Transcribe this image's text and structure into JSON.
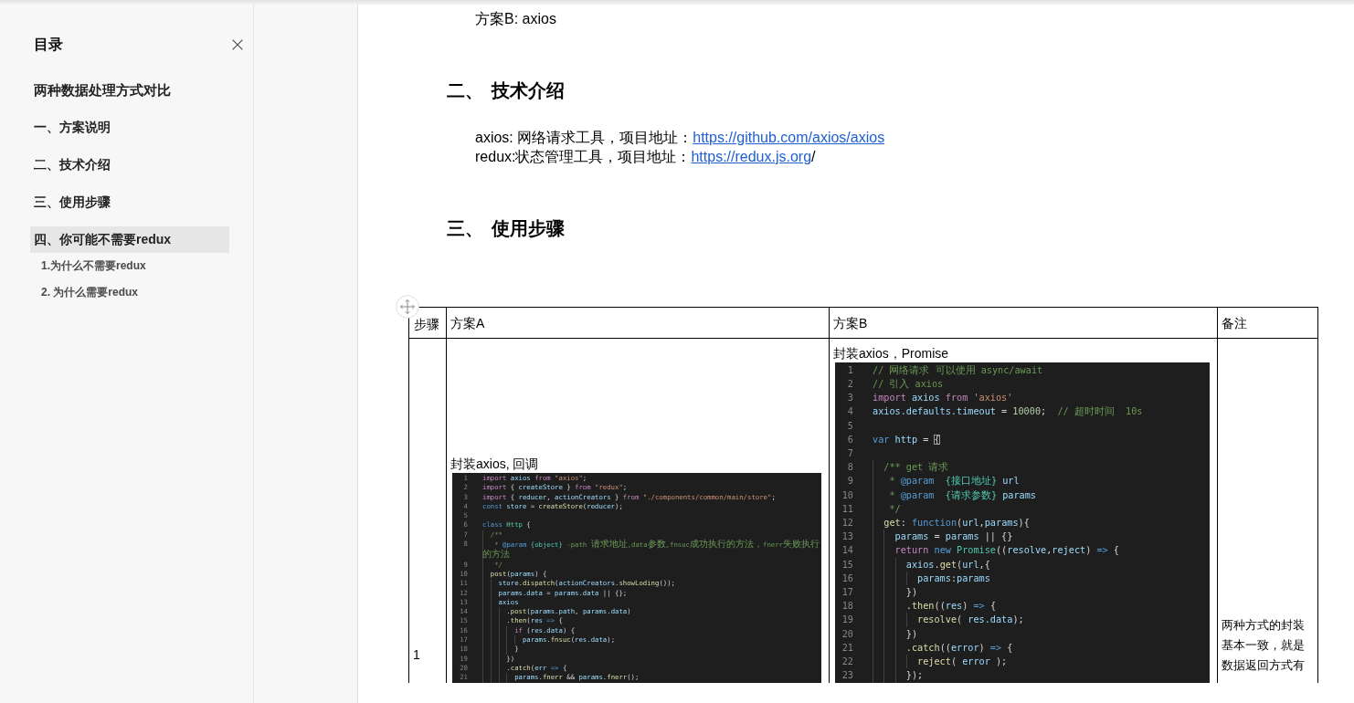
{
  "toc": {
    "title": "目录",
    "items": [
      {
        "kind": "title",
        "label": "两种数据处理方式对比",
        "selected": false
      },
      {
        "kind": "section",
        "label": "一、方案说明",
        "selected": false
      },
      {
        "kind": "section",
        "label": "二、技术介绍",
        "selected": false
      },
      {
        "kind": "section",
        "label": "三、使用步骤",
        "selected": false
      },
      {
        "kind": "section",
        "label": "四、你可能不需要redux",
        "selected": true,
        "children": [
          {
            "label": "1.为什么不需要redux",
            "selected": false
          },
          {
            "label": "2. 为什么需要redux",
            "selected": false
          }
        ]
      }
    ]
  },
  "article": {
    "intro": "方案B: axios",
    "sections": [
      {
        "number": "二、",
        "title": "技术介绍",
        "lines": [
          {
            "text": "axios: 网络请求工具，项目地址：",
            "link": "https://github.com/axios/axios"
          },
          {
            "text": "redux:状态管理工具，项目地址：",
            "link": "https://redux.js.org",
            "trailing": "/"
          }
        ]
      },
      {
        "number": "三、",
        "title": "使用步骤",
        "table": {
          "columns": [
            "步骤",
            "方案A",
            "方案B",
            "备注"
          ],
          "rows": [
            {
              "step": "1",
              "scheme_a": {
                "caption": "封装axios, 回调",
                "code": [
                  {
                    "number": "1",
                    "tokens": [
                      {
                        "text": "import",
                        "kind": "keyword"
                      },
                      {
                        "text": " axios ",
                        "kind": "variable"
                      },
                      {
                        "text": "from",
                        "kind": "keyword"
                      },
                      {
                        "text": " \"axios\"",
                        "kind": "string"
                      },
                      {
                        "text": ";",
                        "kind": "plain"
                      }
                    ]
                  },
                  {
                    "number": "2",
                    "tokens": [
                      {
                        "text": "import",
                        "kind": "keyword"
                      },
                      {
                        "text": " { ",
                        "kind": "plain"
                      },
                      {
                        "text": "createStore",
                        "kind": "variable"
                      },
                      {
                        "text": " } ",
                        "kind": "plain"
                      },
                      {
                        "text": "from",
                        "kind": "keyword"
                      },
                      {
                        "text": " \"redux\"",
                        "kind": "string"
                      },
                      {
                        "text": ";",
                        "kind": "plain"
                      }
                    ]
                  },
                  {
                    "number": "3",
                    "tokens": [
                      {
                        "text": "import",
                        "kind": "keyword"
                      },
                      {
                        "text": " { ",
                        "kind": "plain"
                      },
                      {
                        "text": "reducer",
                        "kind": "variable"
                      },
                      {
                        "text": ", ",
                        "kind": "plain"
                      },
                      {
                        "text": "actionCreators",
                        "kind": "variable"
                      },
                      {
                        "text": " } ",
                        "kind": "plain"
                      },
                      {
                        "text": "from",
                        "kind": "keyword"
                      },
                      {
                        "text": " \"./components/common/main/store\"",
                        "kind": "string"
                      },
                      {
                        "text": ";",
                        "kind": "plain"
                      }
                    ]
                  },
                  {
                    "number": "4",
                    "tokens": [
                      {
                        "text": "const",
                        "kind": "storage"
                      },
                      {
                        "text": " store",
                        "kind": "variable"
                      },
                      {
                        "text": " = ",
                        "kind": "plain"
                      },
                      {
                        "text": "createStore",
                        "kind": "function"
                      },
                      {
                        "text": "(",
                        "kind": "plain"
                      },
                      {
                        "text": "reducer",
                        "kind": "variable"
                      },
                      {
                        "text": ");",
                        "kind": "plain"
                      }
                    ]
                  },
                  {
                    "number": "5"
                  },
                  {
                    "number": "6",
                    "tokens": [
                      {
                        "text": "class",
                        "kind": "storage"
                      },
                      {
                        "text": " Http",
                        "kind": "type"
                      },
                      {
                        "text": " {",
                        "kind": "plain"
                      }
                    ]
                  },
                  {
                    "number": "7",
                    "tokens": [
                      {
                        "text": "  /**",
                        "kind": "comment"
                      }
                    ]
                  },
                  {
                    "number": "8",
                    "tokens": [
                      {
                        "text": "   * ",
                        "kind": "comment"
                      },
                      {
                        "text": "@param",
                        "kind": "storage"
                      },
                      {
                        "text": " {object}",
                        "kind": "type"
                      },
                      {
                        "text": " -path 请求地址,data参数,fnsuc成功执行的方法，fnerr失败执行的方法",
                        "kind": "comment"
                      }
                    ]
                  },
                  {
                    "number": "9",
                    "tokens": [
                      {
                        "text": "   */",
                        "kind": "comment"
                      }
                    ]
                  },
                  {
                    "number": "10",
                    "tokens": [
                      {
                        "text": "  post",
                        "kind": "function"
                      },
                      {
                        "text": "(",
                        "kind": "plain"
                      },
                      {
                        "text": "params",
                        "kind": "variable"
                      },
                      {
                        "text": ") {",
                        "kind": "plain"
                      }
                    ]
                  },
                  {
                    "number": "11",
                    "tokens": [
                      {
                        "text": "    store",
                        "kind": "variable"
                      },
                      {
                        "text": ".",
                        "kind": "plain"
                      },
                      {
                        "text": "dispatch",
                        "kind": "function"
                      },
                      {
                        "text": "(",
                        "kind": "plain"
                      },
                      {
                        "text": "actionCreators",
                        "kind": "variable"
                      },
                      {
                        "text": ".",
                        "kind": "plain"
                      },
                      {
                        "text": "showLoding",
                        "kind": "function"
                      },
                      {
                        "text": "());",
                        "kind": "plain"
                      }
                    ]
                  },
                  {
                    "number": "12",
                    "tokens": [
                      {
                        "text": "    params.data",
                        "kind": "variable"
                      },
                      {
                        "text": " = ",
                        "kind": "plain"
                      },
                      {
                        "text": "params.data",
                        "kind": "variable"
                      },
                      {
                        "text": " || {};",
                        "kind": "plain"
                      }
                    ]
                  },
                  {
                    "number": "13",
                    "tokens": [
                      {
                        "text": "    axios",
                        "kind": "variable"
                      }
                    ]
                  },
                  {
                    "number": "14",
                    "tokens": [
                      {
                        "text": "      .",
                        "kind": "plain"
                      },
                      {
                        "text": "post",
                        "kind": "function"
                      },
                      {
                        "text": "(",
                        "kind": "plain"
                      },
                      {
                        "text": "params.path",
                        "kind": "variable"
                      },
                      {
                        "text": ", ",
                        "kind": "plain"
                      },
                      {
                        "text": "params.data",
                        "kind": "variable"
                      },
                      {
                        "text": ")",
                        "kind": "plain"
                      }
                    ]
                  },
                  {
                    "number": "15",
                    "tokens": [
                      {
                        "text": "      .",
                        "kind": "plain"
                      },
                      {
                        "text": "then",
                        "kind": "function"
                      },
                      {
                        "text": "(",
                        "kind": "plain"
                      },
                      {
                        "text": "res",
                        "kind": "variable"
                      },
                      {
                        "text": " =>",
                        "kind": "storage"
                      },
                      {
                        "text": " {",
                        "kind": "plain"
                      }
                    ]
                  },
                  {
                    "number": "16",
                    "tokens": [
                      {
                        "text": "        if",
                        "kind": "keyword"
                      },
                      {
                        "text": " (",
                        "kind": "plain"
                      },
                      {
                        "text": "res.data",
                        "kind": "variable"
                      },
                      {
                        "text": ") {",
                        "kind": "plain"
                      }
                    ]
                  },
                  {
                    "number": "17",
                    "tokens": [
                      {
                        "text": "          params",
                        "kind": "variable"
                      },
                      {
                        "text": ".",
                        "kind": "plain"
                      },
                      {
                        "text": "fnsuc",
                        "kind": "function"
                      },
                      {
                        "text": "(",
                        "kind": "plain"
                      },
                      {
                        "text": "res.data",
                        "kind": "variable"
                      },
                      {
                        "text": ");",
                        "kind": "plain"
                      }
                    ]
                  },
                  {
                    "number": "18",
                    "tokens": [
                      {
                        "text": "        }",
                        "kind": "plain"
                      }
                    ]
                  },
                  {
                    "number": "19",
                    "tokens": [
                      {
                        "text": "      })",
                        "kind": "plain"
                      }
                    ]
                  },
                  {
                    "number": "20",
                    "tokens": [
                      {
                        "text": "      .",
                        "kind": "plain"
                      },
                      {
                        "text": "catch",
                        "kind": "function"
                      },
                      {
                        "text": "(",
                        "kind": "plain"
                      },
                      {
                        "text": "err",
                        "kind": "variable"
                      },
                      {
                        "text": " =>",
                        "kind": "storage"
                      },
                      {
                        "text": " {",
                        "kind": "plain"
                      }
                    ]
                  },
                  {
                    "number": "21",
                    "tokens": [
                      {
                        "text": "        params",
                        "kind": "variable"
                      },
                      {
                        "text": ".",
                        "kind": "plain"
                      },
                      {
                        "text": "fnerr",
                        "kind": "function"
                      },
                      {
                        "text": " && ",
                        "kind": "plain"
                      },
                      {
                        "text": "params",
                        "kind": "variable"
                      },
                      {
                        "text": ".",
                        "kind": "plain"
                      },
                      {
                        "text": "fnerr",
                        "kind": "function"
                      },
                      {
                        "text": "();",
                        "kind": "plain"
                      }
                    ]
                  }
                ]
              },
              "scheme_b": {
                "caption": "封装axios，Promise",
                "code": [
                  {
                    "number": "1",
                    "tokens": [
                      {
                        "text": "// 网络请求 可以使用 async/await",
                        "kind": "comment"
                      }
                    ]
                  },
                  {
                    "number": "2",
                    "tokens": [
                      {
                        "text": "// 引入 axios",
                        "kind": "comment"
                      }
                    ]
                  },
                  {
                    "number": "3",
                    "tokens": [
                      {
                        "text": "import",
                        "kind": "keyword"
                      },
                      {
                        "text": " axios ",
                        "kind": "variable"
                      },
                      {
                        "text": "from",
                        "kind": "keyword"
                      },
                      {
                        "text": " 'axios'",
                        "kind": "string"
                      }
                    ]
                  },
                  {
                    "number": "4",
                    "tokens": [
                      {
                        "text": "axios.defaults.timeout",
                        "kind": "variable"
                      },
                      {
                        "text": " = ",
                        "kind": "plain"
                      },
                      {
                        "text": "10000",
                        "kind": "number"
                      },
                      {
                        "text": ";  ",
                        "kind": "plain"
                      },
                      {
                        "text": "// 超时时间  10s",
                        "kind": "comment"
                      }
                    ]
                  },
                  {
                    "number": "5"
                  },
                  {
                    "number": "6",
                    "tokens": [
                      {
                        "text": "var",
                        "kind": "storage"
                      },
                      {
                        "text": " http",
                        "kind": "variable"
                      },
                      {
                        "text": " = ",
                        "kind": "plain"
                      },
                      {
                        "text": "{",
                        "kind": "match"
                      }
                    ]
                  },
                  {
                    "number": "7"
                  },
                  {
                    "number": "8",
                    "tokens": [
                      {
                        "text": "  /** get 请求",
                        "kind": "comment"
                      }
                    ]
                  },
                  {
                    "number": "9",
                    "tokens": [
                      {
                        "text": "   * ",
                        "kind": "comment"
                      },
                      {
                        "text": "@param",
                        "kind": "storage"
                      },
                      {
                        "text": "  {接口地址}",
                        "kind": "type"
                      },
                      {
                        "text": " url",
                        "kind": "variable"
                      }
                    ]
                  },
                  {
                    "number": "10",
                    "tokens": [
                      {
                        "text": "   * ",
                        "kind": "comment"
                      },
                      {
                        "text": "@param",
                        "kind": "storage"
                      },
                      {
                        "text": "  {请求参数}",
                        "kind": "type"
                      },
                      {
                        "text": " params",
                        "kind": "variable"
                      }
                    ]
                  },
                  {
                    "number": "11",
                    "tokens": [
                      {
                        "text": "   */",
                        "kind": "comment"
                      }
                    ]
                  },
                  {
                    "number": "12",
                    "tokens": [
                      {
                        "text": "  get",
                        "kind": "function"
                      },
                      {
                        "text": ": ",
                        "kind": "plain"
                      },
                      {
                        "text": "function",
                        "kind": "storage"
                      },
                      {
                        "text": "(",
                        "kind": "plain"
                      },
                      {
                        "text": "url",
                        "kind": "variable"
                      },
                      {
                        "text": ",",
                        "kind": "plain"
                      },
                      {
                        "text": "params",
                        "kind": "variable"
                      },
                      {
                        "text": "){",
                        "kind": "plain"
                      }
                    ]
                  },
                  {
                    "number": "13",
                    "tokens": [
                      {
                        "text": "    params",
                        "kind": "variable"
                      },
                      {
                        "text": " = ",
                        "kind": "plain"
                      },
                      {
                        "text": "params",
                        "kind": "variable"
                      },
                      {
                        "text": " || {}",
                        "kind": "plain"
                      }
                    ]
                  },
                  {
                    "number": "14",
                    "tokens": [
                      {
                        "text": "    return",
                        "kind": "keyword"
                      },
                      {
                        "text": " new",
                        "kind": "storage"
                      },
                      {
                        "text": " Promise",
                        "kind": "type"
                      },
                      {
                        "text": "((",
                        "kind": "plain"
                      },
                      {
                        "text": "resolve",
                        "kind": "variable"
                      },
                      {
                        "text": ",",
                        "kind": "plain"
                      },
                      {
                        "text": "reject",
                        "kind": "variable"
                      },
                      {
                        "text": ") ",
                        "kind": "plain"
                      },
                      {
                        "text": "=>",
                        "kind": "storage"
                      },
                      {
                        "text": " {",
                        "kind": "plain"
                      }
                    ]
                  },
                  {
                    "number": "15",
                    "tokens": [
                      {
                        "text": "      axios",
                        "kind": "variable"
                      },
                      {
                        "text": ".",
                        "kind": "plain"
                      },
                      {
                        "text": "get",
                        "kind": "function"
                      },
                      {
                        "text": "(",
                        "kind": "plain"
                      },
                      {
                        "text": "url",
                        "kind": "variable"
                      },
                      {
                        "text": ",{",
                        "kind": "plain"
                      }
                    ]
                  },
                  {
                    "number": "16",
                    "tokens": [
                      {
                        "text": "        params",
                        "kind": "variable"
                      },
                      {
                        "text": ":",
                        "kind": "plain"
                      },
                      {
                        "text": "params",
                        "kind": "variable"
                      }
                    ]
                  },
                  {
                    "number": "17",
                    "tokens": [
                      {
                        "text": "      })",
                        "kind": "plain"
                      }
                    ]
                  },
                  {
                    "number": "18",
                    "tokens": [
                      {
                        "text": "      .",
                        "kind": "plain"
                      },
                      {
                        "text": "then",
                        "kind": "function"
                      },
                      {
                        "text": "((",
                        "kind": "plain"
                      },
                      {
                        "text": "res",
                        "kind": "variable"
                      },
                      {
                        "text": ") ",
                        "kind": "plain"
                      },
                      {
                        "text": "=>",
                        "kind": "storage"
                      },
                      {
                        "text": " {",
                        "kind": "plain"
                      }
                    ]
                  },
                  {
                    "number": "19",
                    "tokens": [
                      {
                        "text": "        resolve",
                        "kind": "function"
                      },
                      {
                        "text": "( ",
                        "kind": "plain"
                      },
                      {
                        "text": "res.data",
                        "kind": "variable"
                      },
                      {
                        "text": ");",
                        "kind": "plain"
                      }
                    ]
                  },
                  {
                    "number": "20",
                    "tokens": [
                      {
                        "text": "      })",
                        "kind": "plain"
                      }
                    ]
                  },
                  {
                    "number": "21",
                    "tokens": [
                      {
                        "text": "      .",
                        "kind": "plain"
                      },
                      {
                        "text": "catch",
                        "kind": "function"
                      },
                      {
                        "text": "((",
                        "kind": "plain"
                      },
                      {
                        "text": "error",
                        "kind": "variable"
                      },
                      {
                        "text": ") ",
                        "kind": "plain"
                      },
                      {
                        "text": "=>",
                        "kind": "storage"
                      },
                      {
                        "text": " {",
                        "kind": "plain"
                      }
                    ]
                  },
                  {
                    "number": "22",
                    "tokens": [
                      {
                        "text": "        reject",
                        "kind": "function"
                      },
                      {
                        "text": "( ",
                        "kind": "plain"
                      },
                      {
                        "text": "error",
                        "kind": "variable"
                      },
                      {
                        "text": " );",
                        "kind": "plain"
                      }
                    ]
                  },
                  {
                    "number": "23",
                    "tokens": [
                      {
                        "text": "      });",
                        "kind": "plain"
                      }
                    ]
                  }
                ]
              },
              "note": "两种方式的封装基本一致，就是数据返回方式有"
            }
          ]
        }
      }
    ]
  }
}
